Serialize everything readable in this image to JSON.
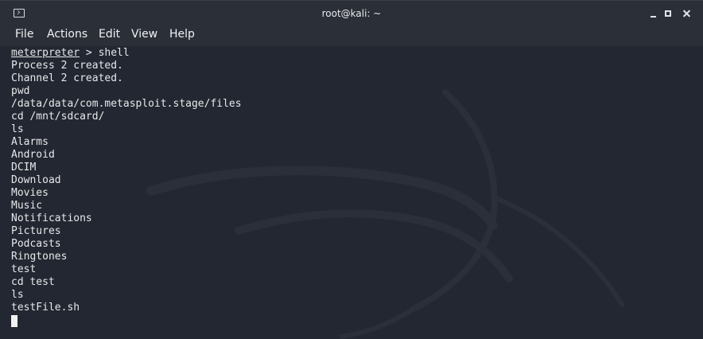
{
  "window": {
    "title": "root@kali: ~",
    "icon": "terminal-icon",
    "controls": [
      "minimize-icon",
      "maximize-icon",
      "close-icon"
    ]
  },
  "menu": {
    "items": [
      {
        "label": "File"
      },
      {
        "label": "Actions"
      },
      {
        "label": "Edit"
      },
      {
        "label": "View"
      },
      {
        "label": "Help"
      }
    ]
  },
  "terminal": {
    "prompt_word": "meterpreter",
    "prompt_rest": " > shell",
    "output": [
      "Process 2 created.",
      "Channel 2 created.",
      "pwd",
      "/data/data/com.metasploit.stage/files",
      "cd /mnt/sdcard/",
      "ls",
      "Alarms",
      "Android",
      "DCIM",
      "Download",
      "Movies",
      "Music",
      "Notifications",
      "Pictures",
      "Podcasts",
      "Ringtones",
      "test",
      "cd test",
      "ls",
      "testFile.sh"
    ]
  },
  "colors": {
    "background": "#232731",
    "text": "#e6e8eb",
    "titlebar": "#2b2f38"
  }
}
